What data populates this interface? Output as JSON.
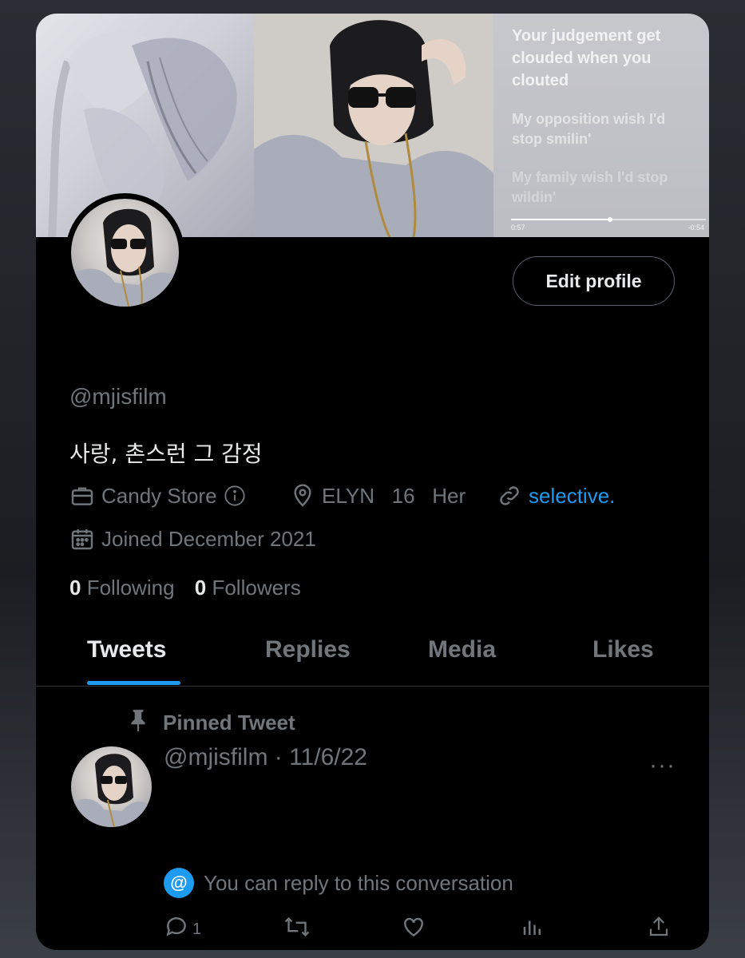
{
  "banner": {
    "lyrics": {
      "current": "Your judgement get clouded when you clouted",
      "next1": "My opposition wish I'd stop smilin'",
      "next2": "My family wish I'd stop wildin'"
    },
    "player": {
      "elapsed": "0:57",
      "remaining": "-0:54",
      "progress": 0.51
    }
  },
  "profile": {
    "edit_label": "Edit profile",
    "handle": "@mjisfilm",
    "bio": "사랑, 촌스런 그 감정",
    "category": "Candy Store",
    "location": "ELYN   16   Her",
    "website": "selective.",
    "joined": "Joined December 2021",
    "following_count": "0",
    "following_label": "Following",
    "followers_count": "0",
    "followers_label": "Followers"
  },
  "tabs": [
    {
      "label": "Tweets",
      "active": true
    },
    {
      "label": "Replies",
      "active": false
    },
    {
      "label": "Media",
      "active": false
    },
    {
      "label": "Likes",
      "active": false
    }
  ],
  "pinned_tweet": {
    "pinned_label": "Pinned Tweet",
    "header": "@mjisfilm · 11/6/22",
    "more_label": "···",
    "reply_note": "You can reply to this conversation",
    "at_symbol": "@",
    "reply_count": "1"
  },
  "colors": {
    "accent": "#1d9bf0",
    "background": "#000000",
    "secondary_text": "#71767b",
    "primary_text": "#e7e9ea"
  },
  "icons": [
    "briefcase-icon",
    "info-icon",
    "location-pin-icon",
    "link-icon",
    "calendar-icon",
    "pin-icon",
    "reply-icon",
    "retweet-icon",
    "like-icon",
    "views-icon",
    "share-icon"
  ]
}
